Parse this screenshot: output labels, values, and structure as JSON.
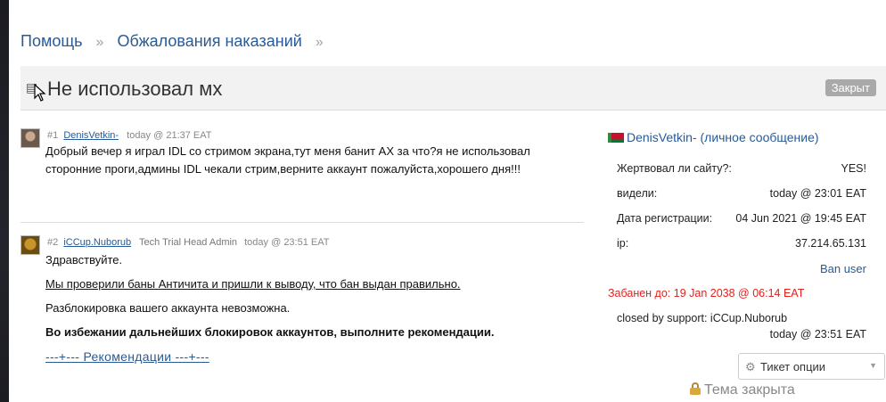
{
  "breadcrumb": {
    "items": [
      "Помощь",
      "Обжалования наказаний"
    ],
    "separator": "»"
  },
  "topic": {
    "title": "Не использовал мх",
    "status": "Закрыт"
  },
  "posts": [
    {
      "number": "#1",
      "author": "DenisVetkin-",
      "role": "",
      "time": "today @ 21:37 EAT",
      "text": "Добрый вечер я играл IDL со стримом экрана,тут меня банит АХ за что?я не использовал сторонние проги,админы IDL чекали стрим,верните аккаунт пожалуйста,хорошего дня!!!"
    },
    {
      "number": "#2",
      "author": "iCCup.Nuborub",
      "role": "Tech Trial Head Admin",
      "time": "today @ 23:51 EAT",
      "paragraphs": [
        "Здравствуйте.",
        "Мы проверили баны Античита и пришли к выводу, что бан выдан правильно.",
        "Разблокировка вашего аккаунта невозможна.",
        "Во избежании дальнейших блокировок аккаунтов, выполните рекомендации."
      ],
      "spoiler": "---+--- Рекомендации ---+---"
    }
  ],
  "sidebar": {
    "username": "DenisVetkin-",
    "pm_link": "(личное сообщение)",
    "rows": [
      {
        "label": "Жертвовал ли сайту?:",
        "value": "YES!"
      },
      {
        "label": "видели:",
        "value": "today @ 23:01 EAT"
      },
      {
        "label": "Дата регистрации:",
        "value": "04 Jun 2021 @ 19:45 EAT"
      },
      {
        "label": "ip:",
        "value": "37.214.65.131"
      }
    ],
    "ban_user": "Ban user",
    "banned_until": "Забанен до: 19 Jan 2038 @ 06:14 EAT",
    "closed_by": "closed by support: iCCup.Nuborub",
    "closed_time": "today @ 23:51 EAT",
    "ticket_options": "Тикет опции",
    "topic_locked": "Тема закрыта"
  },
  "colors": {
    "link": "#2a5a94",
    "danger": "#e3221e",
    "badge": "#a9a9a9"
  }
}
